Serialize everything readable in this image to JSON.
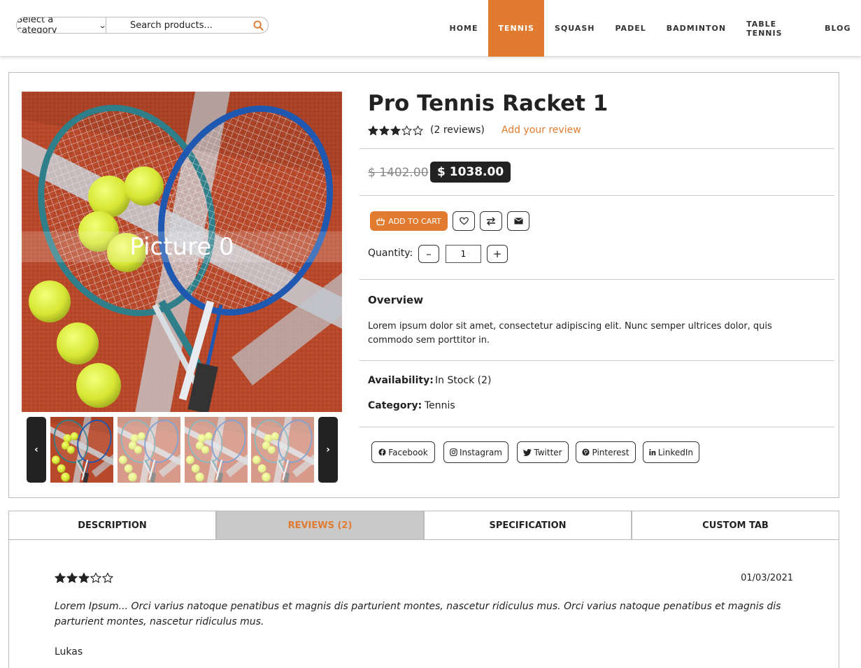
{
  "header": {
    "category_select": "Select a category",
    "search_placeholder": "Search products...",
    "nav": [
      "HOME",
      "TENNIS",
      "SQUASH",
      "PADEL",
      "BADMINTON",
      "TABLE TENNIS",
      "BLOG"
    ],
    "active_nav": "TENNIS",
    "accent_color": "#e07b2f"
  },
  "gallery": {
    "caption": "Picture 0",
    "prev_icon": "chevron-left-icon",
    "next_icon": "chevron-right-icon"
  },
  "product": {
    "title": "Pro Tennis Racket 1",
    "rating": 3,
    "rating_max": 5,
    "review_count": "(2 reviews)",
    "add_review": "Add your review",
    "old_price": "$ 1402.00",
    "new_price": "$ 1038.00",
    "add_to_cart": "ADD TO CART",
    "quantity_label": "Quantity:",
    "quantity_value": "1",
    "overview_heading": "Overview",
    "overview_text": "Lorem ipsum dolor sit amet, consectetur adipiscing elit. Nunc semper ultrices dolor, quis commodo sem porttitor in.",
    "availability_label": "Availability:",
    "availability_value": "In Stock (2)",
    "category_label": "Category:",
    "category_value": "Tennis"
  },
  "social": [
    "Facebook",
    "Instagram",
    "Twitter",
    "Pinterest",
    "LinkedIn"
  ],
  "tabs": [
    "DESCRIPTION",
    "REVIEWS (2)",
    "SPECIFICATION",
    "CUSTOM TAB"
  ],
  "active_tab": "REVIEWS (2)",
  "review": {
    "rating": 3,
    "date": "01/03/2021",
    "text": "Lorem Ipsum... Orci varius natoque penatibus et magnis dis parturient montes, nascetur ridiculus mus. Orci varius natoque penatibus et magnis dis parturient montes, nascetur ridiculus mus.",
    "author": "Lukas"
  }
}
